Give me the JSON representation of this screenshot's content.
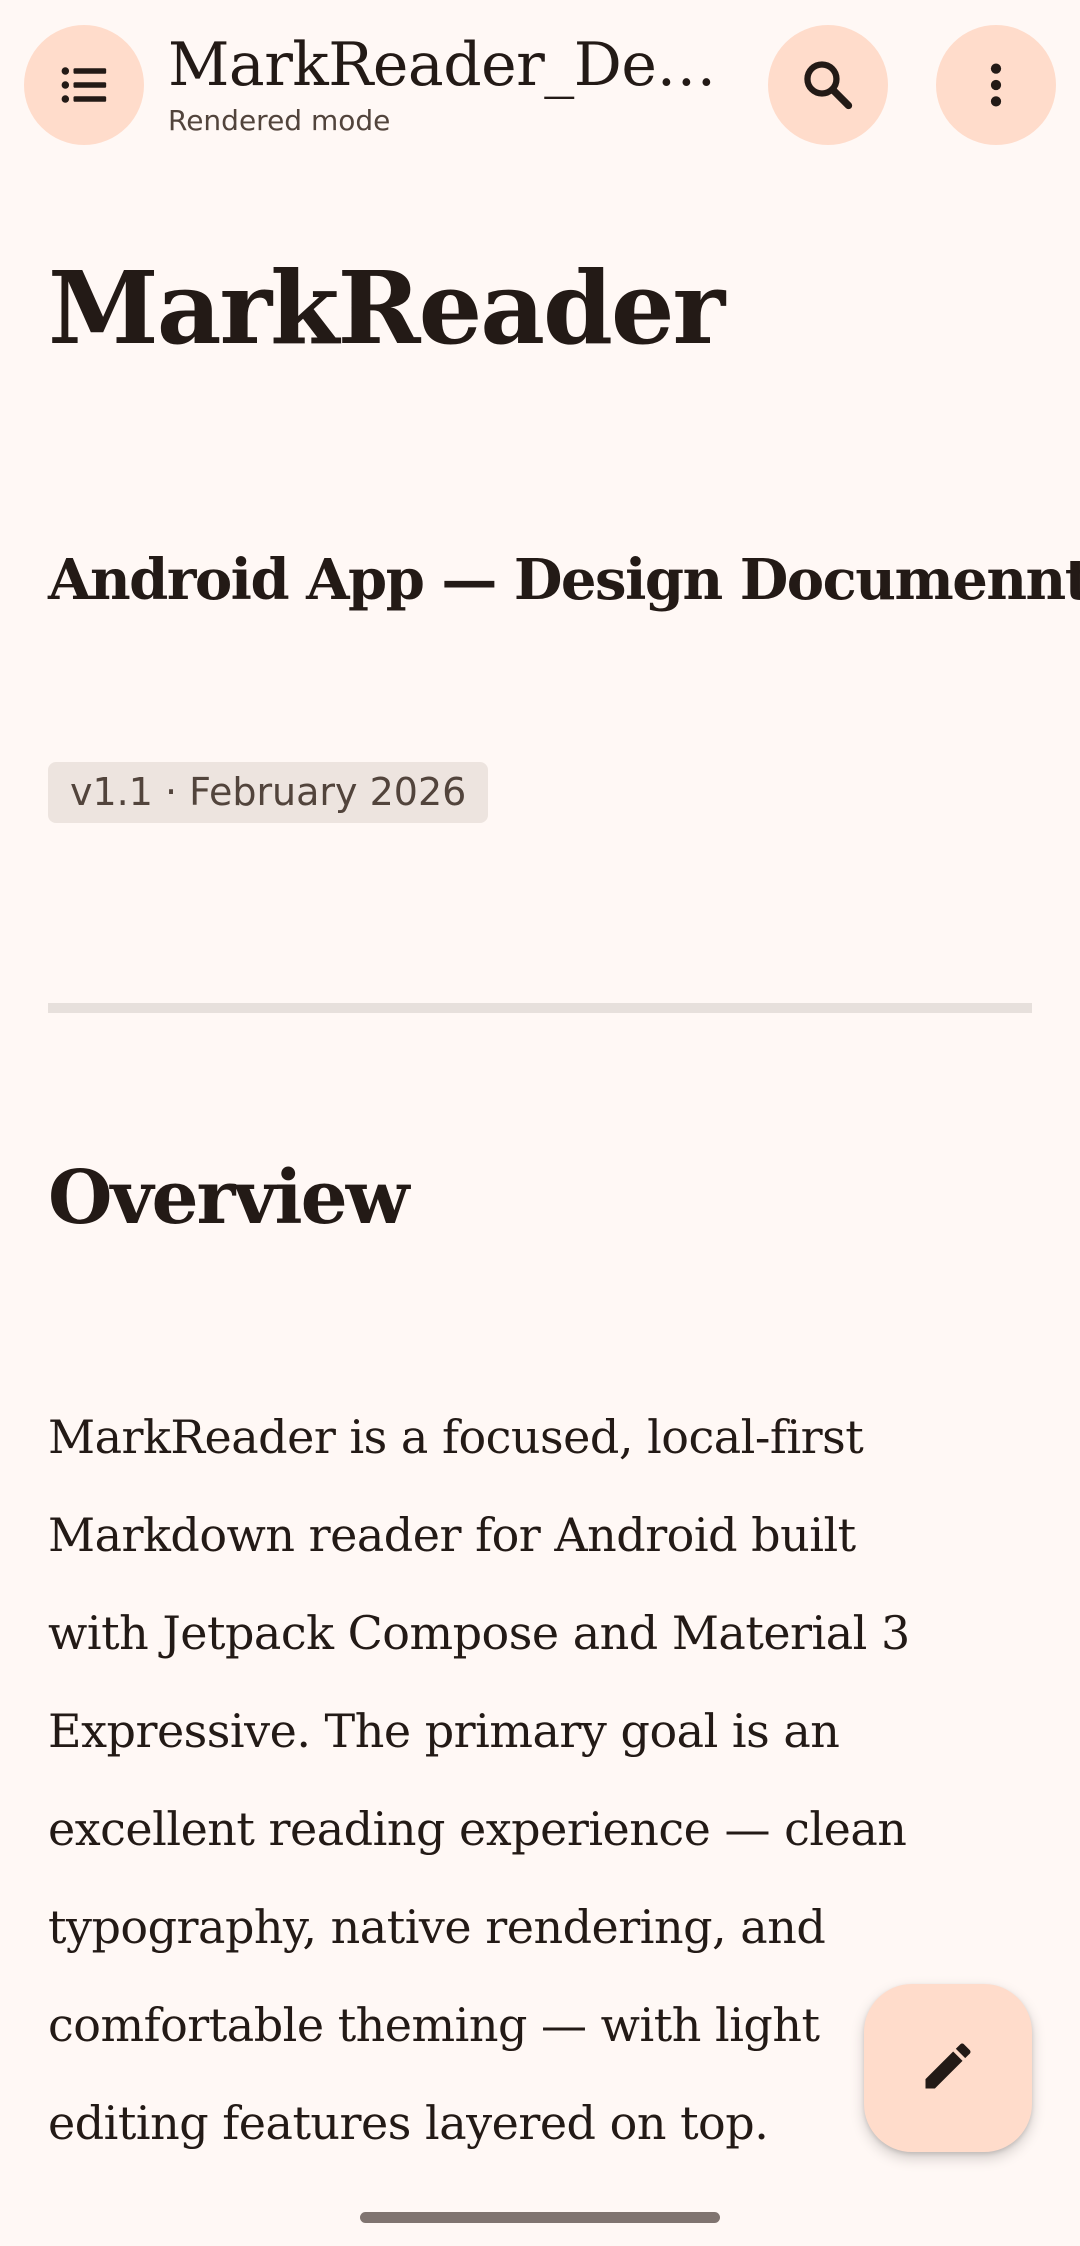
{
  "app_bar": {
    "title": "MarkReader_Desi…",
    "subtitle": "Rendered mode",
    "menu_icon": "list-icon",
    "search_icon": "search-icon",
    "more_icon": "more-vert-icon"
  },
  "document": {
    "heading1": "MarkReader",
    "heading2": "Android App — Design Documennt",
    "version_chip": "v1.1 · February 2026",
    "section_heading": "Overview",
    "paragraph": "MarkReader is a focused, local-first Markdown reader for Android built with Jetpack Compose and Material 3 Expressive. The primary goal is an excellent reading experience — clean typography, native rendering, and comfortable theming — with light editing features layered on top."
  },
  "fab": {
    "icon": "edit-pencil-icon"
  },
  "colors": {
    "background": "#FFF8F5",
    "tonal_button": "#FFDCCB",
    "chip": "#EDE4DF",
    "divider": "#E7E0DC",
    "text": "#231A16"
  }
}
